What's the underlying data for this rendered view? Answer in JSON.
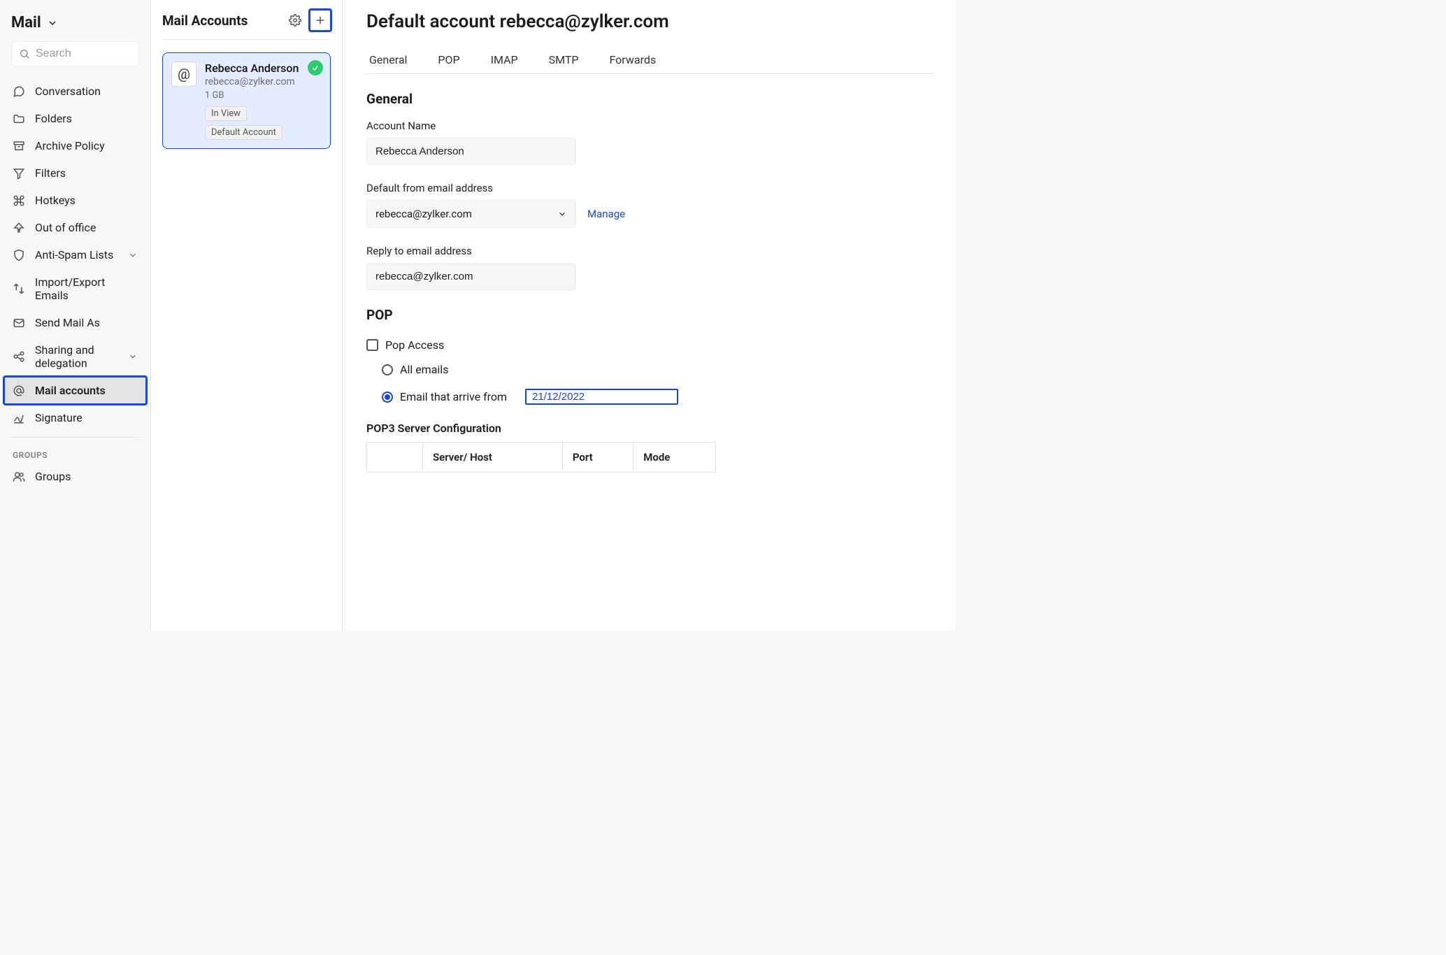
{
  "sidebar": {
    "title": "Mail",
    "search_placeholder": "Search",
    "items": [
      {
        "label": "Conversation",
        "chevron": false
      },
      {
        "label": "Folders",
        "chevron": false
      },
      {
        "label": "Archive Policy",
        "chevron": false
      },
      {
        "label": "Filters",
        "chevron": false
      },
      {
        "label": "Hotkeys",
        "chevron": false
      },
      {
        "label": "Out of office",
        "chevron": false
      },
      {
        "label": "Anti-Spam Lists",
        "chevron": true
      },
      {
        "label": "Import/Export Emails",
        "chevron": false
      },
      {
        "label": "Send Mail As",
        "chevron": false
      },
      {
        "label": "Sharing and delegation",
        "chevron": true
      },
      {
        "label": "Mail accounts",
        "chevron": false,
        "active": true
      },
      {
        "label": "Signature",
        "chevron": false
      }
    ],
    "groups_section_label": "GROUPS",
    "groups_item": "Groups"
  },
  "middle": {
    "title": "Mail Accounts",
    "account": {
      "name": "Rebecca Anderson",
      "email": "rebecca@zylker.com",
      "size": "1 GB",
      "badge_inview": "In View",
      "badge_default": "Default Account"
    }
  },
  "content": {
    "page_title": "Default account rebecca@zylker.com",
    "tabs": [
      "General",
      "POP",
      "IMAP",
      "SMTP",
      "Forwards"
    ],
    "general": {
      "heading": "General",
      "account_name_label": "Account Name",
      "account_name_value": "Rebecca Anderson",
      "default_from_label": "Default from email address",
      "default_from_value": "rebecca@zylker.com",
      "manage_link": "Manage",
      "reply_to_label": "Reply to email address",
      "reply_to_value": "rebecca@zylker.com"
    },
    "pop": {
      "heading": "POP",
      "pop_access_label": "Pop Access",
      "radio_all": "All emails",
      "radio_from": "Email that arrive from",
      "radio_from_date": "21/12/2022",
      "config_heading": "POP3 Server Configuration",
      "table_headers": [
        "",
        "Server/ Host",
        "Port",
        "Mode"
      ]
    }
  }
}
